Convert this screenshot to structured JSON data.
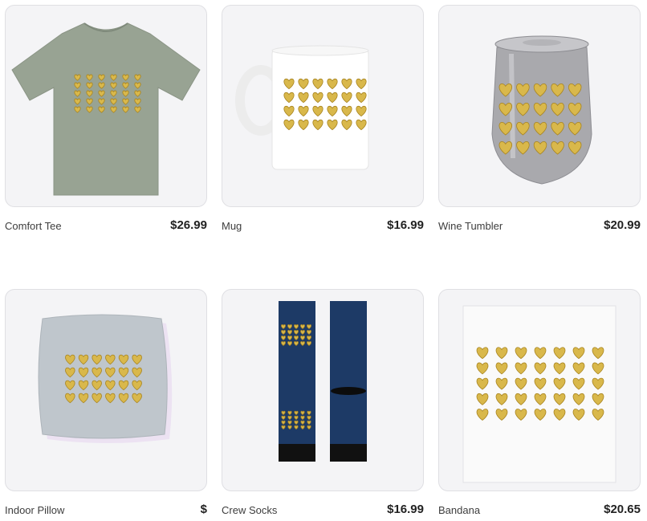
{
  "products": [
    {
      "name": "Comfort Tee",
      "price": "$26.99",
      "color": "#98a393"
    },
    {
      "name": "Mug",
      "price": "$16.99",
      "color": "#ffffff"
    },
    {
      "name": "Wine Tumbler",
      "price": "$20.99",
      "color": "#a9a9ad"
    },
    {
      "name": "Indoor Pillow",
      "price": "$",
      "color": "#bfc6cc"
    },
    {
      "name": "Crew Socks",
      "price": "$16.99",
      "color": "#1d3a66"
    },
    {
      "name": "Bandana",
      "price": "$20.65",
      "color": "#f2f2f4"
    }
  ],
  "design": {
    "heart_color": "#d9b84b",
    "heart_edge": "#a88420"
  }
}
